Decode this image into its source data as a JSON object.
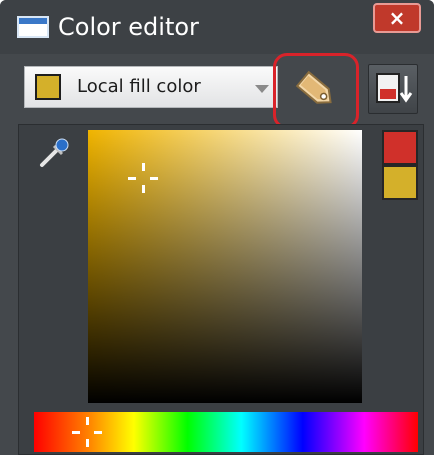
{
  "window": {
    "title": "Color editor",
    "close_label": "×"
  },
  "toolbar": {
    "fill_type_selected": "Local fill color",
    "fill_swatch_color": "#d4b02a"
  },
  "picker": {
    "hue_color": "#f0b400",
    "new_color": "#d0302a",
    "original_color": "#d4b02a"
  },
  "colors": {
    "highlight_outline": "#d9232a",
    "close_button": "#c0392b",
    "window_bg": "#44484c"
  },
  "icons": [
    "color-editor-window-icon",
    "close-icon",
    "chevron-down-icon",
    "tag-icon",
    "color-menu-icon",
    "eyedropper-icon"
  ]
}
